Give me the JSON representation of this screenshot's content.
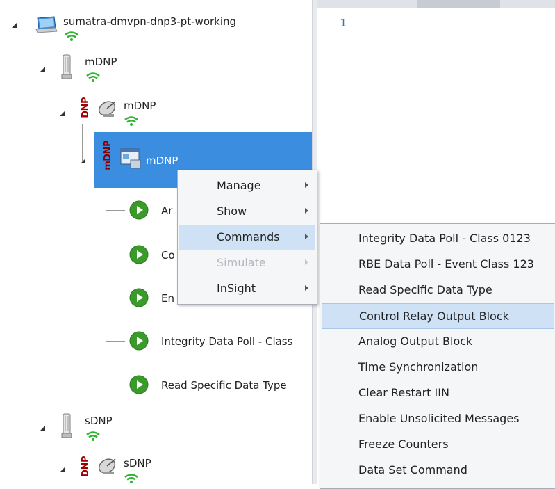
{
  "tree": {
    "root_label": "sumatra-dmvpn-dnp3-pt-working",
    "node_mdnp_1": "mDNP",
    "node_mdnp_2": "mDNP",
    "node_mdnp_selected": "mDNP",
    "dnp_tag": "DNP",
    "mdnp_tag": "mDNP",
    "children": [
      {
        "label": "Ar"
      },
      {
        "label": "Co"
      },
      {
        "label": "En"
      },
      {
        "label": "Integrity Data Poll - Class"
      },
      {
        "label": "Read Specific Data Type"
      }
    ],
    "node_sdnp_1": "sDNP",
    "node_sdnp_2": "sDNP"
  },
  "editor": {
    "line_number": "1"
  },
  "context_menu": {
    "items": [
      {
        "label": "Manage",
        "disabled": false
      },
      {
        "label": "Show",
        "disabled": false
      },
      {
        "label": "Commands",
        "disabled": false
      },
      {
        "label": "Simulate",
        "disabled": true
      },
      {
        "label": "InSight",
        "disabled": false
      }
    ]
  },
  "commands_submenu": {
    "items": [
      {
        "label": "Integrity Data Poll - Class 0123"
      },
      {
        "label": "RBE Data Poll - Event Class 123"
      },
      {
        "label": "Read Specific Data Type"
      },
      {
        "label": "Control Relay Output Block"
      },
      {
        "label": "Analog Output Block"
      },
      {
        "label": "Time Synchronization"
      },
      {
        "label": "Clear Restart IIN"
      },
      {
        "label": "Enable Unsolicited Messages"
      },
      {
        "label": "Freeze Counters"
      },
      {
        "label": "Data Set Command"
      }
    ]
  },
  "colors": {
    "selection": "#3b8de0",
    "menu_hover": "#cfe2f5",
    "wifi": "#2fb52f",
    "play": "#3a9a2a"
  }
}
